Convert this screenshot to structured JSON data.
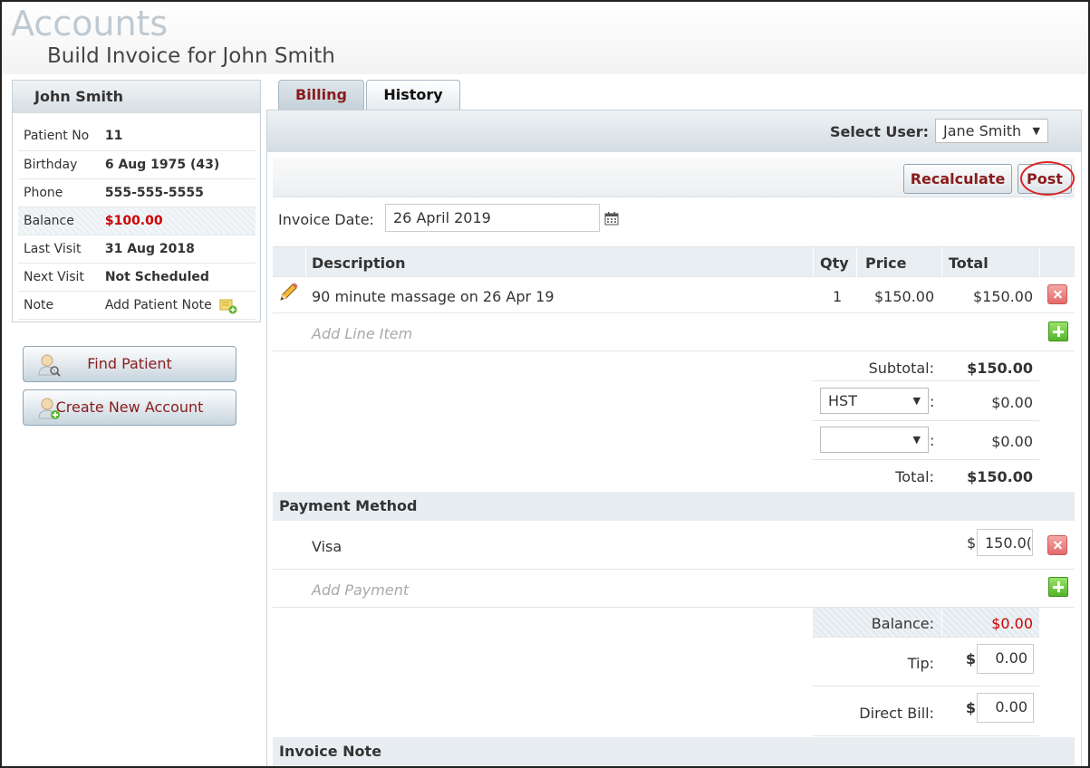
{
  "header": {
    "app_title": "Accounts",
    "subtitle": "Build Invoice for John Smith"
  },
  "patient": {
    "name": "John Smith",
    "fields": [
      {
        "label": "Patient No",
        "value": "11"
      },
      {
        "label": "Birthday",
        "value": "6 Aug 1975 (43)"
      },
      {
        "label": "Phone",
        "value": "555-555-5555"
      },
      {
        "label": "Balance",
        "value": "$100.00"
      },
      {
        "label": "Last Visit",
        "value": "31 Aug 2018"
      },
      {
        "label": "Next Visit",
        "value": "Not Scheduled"
      },
      {
        "label": "Note",
        "value": "Add Patient Note"
      }
    ]
  },
  "sidebar_buttons": {
    "find": "Find Patient",
    "create": "Create New Account"
  },
  "tabs": {
    "billing": "Billing",
    "history": "History"
  },
  "user_select": {
    "label": "Select User:",
    "value": "Jane Smith"
  },
  "toolbar": {
    "recalculate": "Recalculate",
    "post": "Post"
  },
  "invoice": {
    "date_label": "Invoice Date:",
    "date_value": "26 April 2019"
  },
  "table": {
    "headers": {
      "description": "Description",
      "qty": "Qty",
      "price": "Price",
      "total": "Total"
    },
    "items": [
      {
        "description": "90 minute massage on 26 Apr 19",
        "qty": "1",
        "price": "$150.00",
        "total": "$150.00"
      }
    ],
    "add_placeholder": "Add Line Item"
  },
  "totals": {
    "subtotal_label": "Subtotal:",
    "subtotal": "$150.00",
    "tax1_select": "HST",
    "tax1_colon": ":",
    "tax1": "$0.00",
    "tax2_select": "",
    "tax2_colon": ":",
    "tax2": "$0.00",
    "total_label": "Total:",
    "total": "$150.00"
  },
  "payment": {
    "section": "Payment Method",
    "method": "Visa",
    "currency": "$",
    "amount": "150.0(",
    "add_placeholder": "Add Payment",
    "balance_label": "Balance:",
    "balance": "$0.00",
    "tip_label": "Tip:",
    "tip_currency": "$",
    "tip": "0.00",
    "direct_label": "Direct Bill:",
    "direct_currency": "$",
    "direct": "0.00"
  },
  "note": {
    "section": "Invoice Note"
  }
}
